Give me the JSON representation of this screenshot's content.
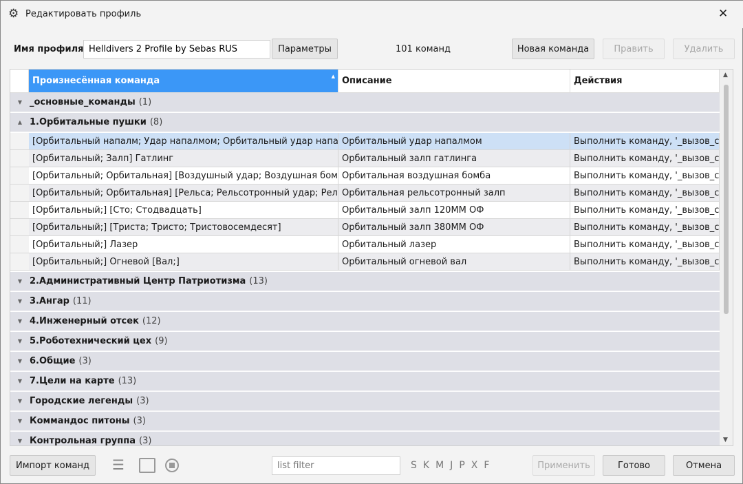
{
  "window": {
    "title": "Редактировать профиль",
    "close": "✕"
  },
  "profile": {
    "label": "Имя профиля",
    "value": "Helldivers 2 Profile by Sebas RUS",
    "params_button": "Параметры",
    "count": "101 команд",
    "new_button": "Новая команда",
    "edit_button": "Править",
    "delete_button": "Удалить"
  },
  "columns": [
    "Произнесённая команда",
    "Описание",
    "Действия"
  ],
  "groups_top": [
    {
      "name": "_основные_команды",
      "count": "(1)",
      "expanded": false
    },
    {
      "name": "1.Орбитальные пушки",
      "count": "(8)",
      "expanded": true
    }
  ],
  "items": [
    {
      "cmd": "[Орбитальный напалм; Удар напалмом; Орбитальный удар напалм",
      "desc": "Орбитальный удар напалмом",
      "act": "Выполнить команду, '_вызов_ст"
    },
    {
      "cmd": "[Орбитальный; Залп] Гатлинг",
      "desc": "Орбитальный залп гатлинга",
      "act": "Выполнить команду, '_вызов_ст"
    },
    {
      "cmd": "[Орбитальный; Орбитальная] [Воздушный удар; Воздушная бомба]",
      "desc": "Орбитальная воздушная бомба",
      "act": "Выполнить команду, '_вызов_ст"
    },
    {
      "cmd": "[Орбитальный; Орбитальная] [Рельса; Рельсотронный удар; Рельсо",
      "desc": "Орбитальная рельсотронный залп",
      "act": "Выполнить команду, '_вызов_ст"
    },
    {
      "cmd": "[Орбитальный;] [Сто; Стодвадцать]",
      "desc": "Орбитальный залп 120ММ ОФ",
      "act": "Выполнить команду, '_вызов_ст"
    },
    {
      "cmd": "[Орбитальный;] [Триста; Тристо; Тристовосемдесят]",
      "desc": "Орбитальный залп 380ММ ОФ",
      "act": "Выполнить команду, '_вызов_ст"
    },
    {
      "cmd": "[Орбитальный;] Лазер",
      "desc": "Орбитальный лазер",
      "act": "Выполнить команду, '_вызов_ст"
    },
    {
      "cmd": "[Орбитальный;] Огневой [Вал;]",
      "desc": "Орбитальный огневой вал",
      "act": "Выполнить команду, '_вызов_ст"
    }
  ],
  "groups_bottom": [
    {
      "name": "2.Административный Центр Патриотизма",
      "count": "(13)"
    },
    {
      "name": "3.Ангар",
      "count": "(11)"
    },
    {
      "name": "4.Инженерный отсек",
      "count": "(12)"
    },
    {
      "name": "5.Роботехнический цех",
      "count": "(9)"
    },
    {
      "name": "6.Общие",
      "count": "(3)"
    },
    {
      "name": "7.Цели на карте",
      "count": "(13)"
    },
    {
      "name": "Городские легенды",
      "count": "(3)"
    },
    {
      "name": "Коммандос питоны",
      "count": "(3)"
    },
    {
      "name": "Контрольная группа",
      "count": "(3)"
    }
  ],
  "footer": {
    "import_button": "Импорт команд",
    "filter_placeholder": "list filter",
    "letters": [
      "S",
      "K",
      "M",
      "J",
      "P",
      "X",
      "F"
    ],
    "apply_button": "Применить",
    "done_button": "Готово",
    "cancel_button": "Отмена"
  },
  "colors": {
    "header_selected": "#3b97f7",
    "group_bg": "#dedfe6",
    "selected_row": "#cde0f6"
  }
}
